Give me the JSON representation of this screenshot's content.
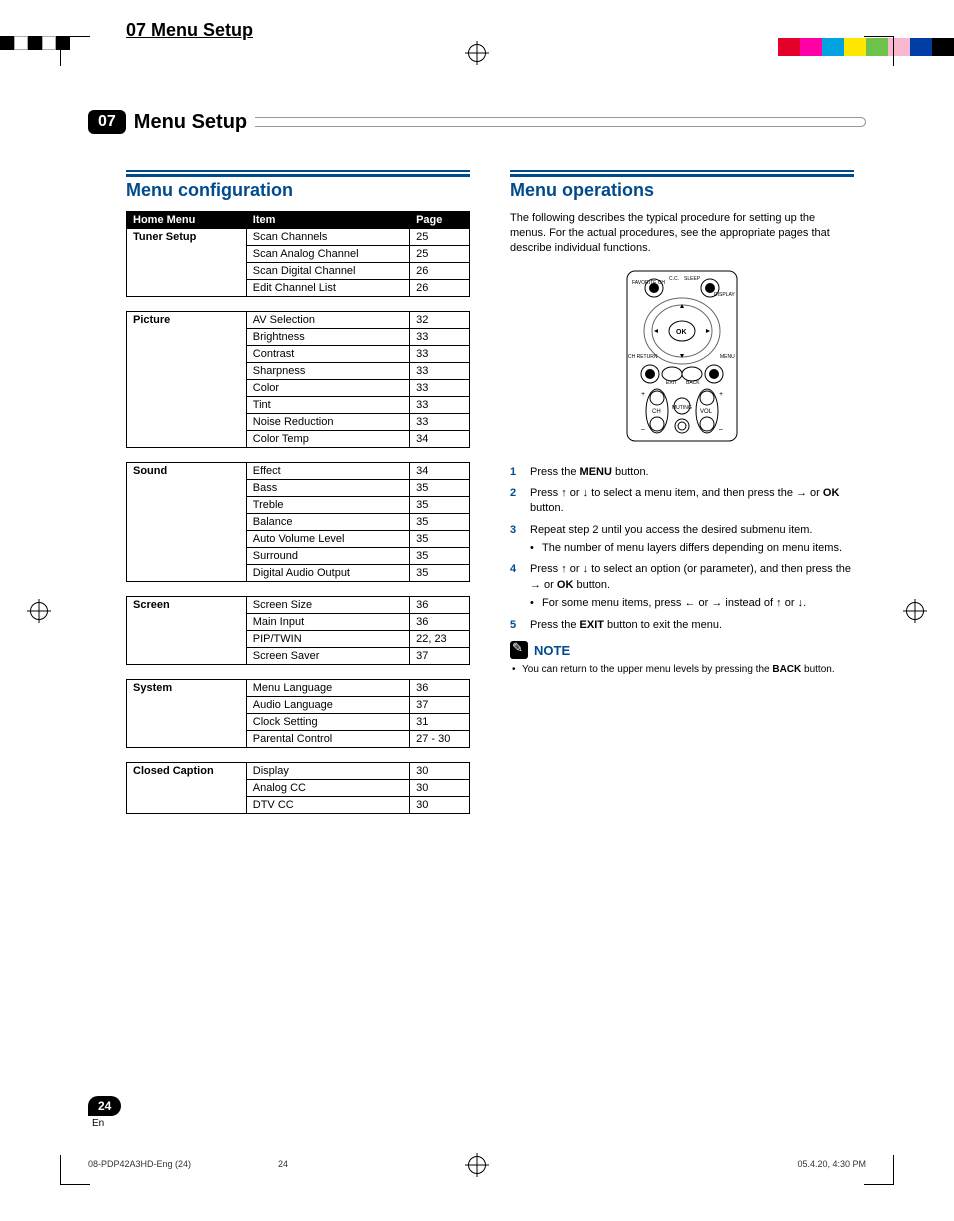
{
  "tab_title": "07 Menu Setup",
  "chapter_number": "07",
  "chapter_title": "Menu Setup",
  "menu_config": {
    "heading": "Menu configuration",
    "header": {
      "home": "Home Menu",
      "item": "Item",
      "page": "Page"
    },
    "groups": [
      {
        "category": "Tuner Setup",
        "rows": [
          {
            "item": "Scan Channels",
            "page": "25"
          },
          {
            "item": "Scan Analog Channel",
            "page": "25"
          },
          {
            "item": "Scan Digital Channel",
            "page": "26"
          },
          {
            "item": "Edit Channel List",
            "page": "26"
          }
        ]
      },
      {
        "category": "Picture",
        "rows": [
          {
            "item": "AV Selection",
            "page": "32"
          },
          {
            "item": "Brightness",
            "page": "33"
          },
          {
            "item": "Contrast",
            "page": "33"
          },
          {
            "item": "Sharpness",
            "page": "33"
          },
          {
            "item": "Color",
            "page": "33"
          },
          {
            "item": "Tint",
            "page": "33"
          },
          {
            "item": "Noise Reduction",
            "page": "33"
          },
          {
            "item": "Color Temp",
            "page": "34"
          }
        ]
      },
      {
        "category": "Sound",
        "rows": [
          {
            "item": "Effect",
            "page": "34"
          },
          {
            "item": "Bass",
            "page": "35"
          },
          {
            "item": "Treble",
            "page": "35"
          },
          {
            "item": "Balance",
            "page": "35"
          },
          {
            "item": "Auto Volume Level",
            "page": "35"
          },
          {
            "item": "Surround",
            "page": "35"
          },
          {
            "item": "Digital Audio Output",
            "page": "35"
          }
        ]
      },
      {
        "category": "Screen",
        "rows": [
          {
            "item": "Screen Size",
            "page": "36"
          },
          {
            "item": "Main Input",
            "page": "36"
          },
          {
            "item": "PIP/TWIN",
            "page": "22, 23"
          },
          {
            "item": "Screen Saver",
            "page": "37"
          }
        ]
      },
      {
        "category": "System",
        "rows": [
          {
            "item": "Menu Language",
            "page": "36"
          },
          {
            "item": "Audio Language",
            "page": "37"
          },
          {
            "item": "Clock Setting",
            "page": "31"
          },
          {
            "item": "Parental Control",
            "page": "27 - 30"
          }
        ]
      },
      {
        "category": "Closed Caption",
        "rows": [
          {
            "item": "Display",
            "page": "30"
          },
          {
            "item": "Analog CC",
            "page": "30"
          },
          {
            "item": "DTV CC",
            "page": "30"
          }
        ]
      }
    ]
  },
  "menu_ops": {
    "heading": "Menu operations",
    "intro": "The following describes the typical procedure for setting up the menus. For the actual procedures, see the appropriate pages that describe individual functions.",
    "remote_labels": {
      "cc": "C.C.",
      "sleep": "SLEEP",
      "favorite": "FAVORITE CH",
      "display": "DISPLAY",
      "ok": "OK",
      "ch_return": "CH RETURN",
      "menu": "MENU",
      "exit": "EXIT",
      "back": "BACK",
      "ch": "CH",
      "muting": "MUTING",
      "vol": "VOL",
      "plus": "+",
      "minus": "–"
    },
    "steps": {
      "s1_a": "Press the ",
      "s1_b": "MENU",
      "s1_c": " button.",
      "s2_a": "Press ",
      "s2_b": " or ",
      "s2_c": " to select a menu item, and then press the ",
      "s2_d": " or ",
      "s2_e": "OK",
      "s2_f": " button.",
      "s3_a": "Repeat step 2 until you access the desired submenu item.",
      "s3_b": "The number of menu layers differs depending on menu items.",
      "s4_a": "Press ",
      "s4_b": " or ",
      "s4_c": " to select an option (or parameter), and then press the ",
      "s4_d": " or ",
      "s4_e": "OK",
      "s4_f": " button.",
      "s4_g": "For some menu items, press ",
      "s4_h": " or ",
      "s4_i": " instead of ",
      "s4_j": " or ",
      "s4_k": ".",
      "s5_a": "Press the ",
      "s5_b": "EXIT",
      "s5_c": " button to exit the menu."
    },
    "note_label": "NOTE",
    "note_body_a": "You can return to the upper menu levels by pressing the ",
    "note_body_b": "BACK",
    "note_body_c": " button."
  },
  "page_number": "24",
  "page_lang": "En",
  "footer_left": "08-PDP42A3HD-Eng (24)",
  "footer_mid": "24",
  "footer_right": "05.4.20, 4:30 PM"
}
